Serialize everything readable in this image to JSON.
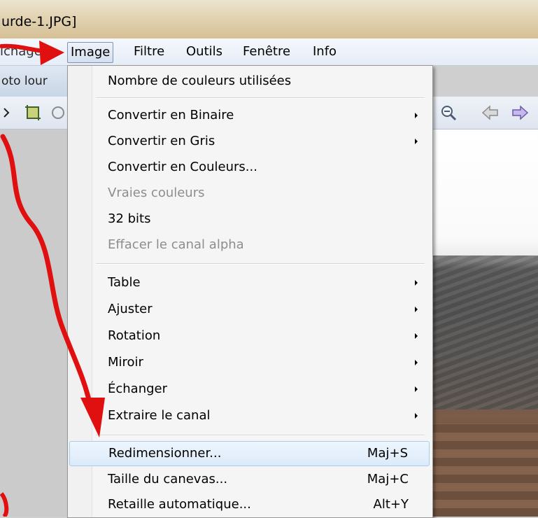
{
  "window": {
    "title_fragment": "urde-1.JPG]"
  },
  "menubar": {
    "partial_item": "ichage",
    "items": [
      {
        "label": "Image",
        "active": true
      },
      {
        "label": "Filtre"
      },
      {
        "label": "Outils"
      },
      {
        "label": "Fenêtre"
      },
      {
        "label": "Info"
      }
    ]
  },
  "tabstrip": {
    "tab_fragment": "oto lour"
  },
  "toolbar": {
    "icons": [
      "crop-icon",
      "zoom-out-icon",
      "back-arrow-icon",
      "forward-arrow-icon"
    ]
  },
  "image_menu": {
    "items": [
      {
        "label": "Nombre de couleurs utilisées",
        "enabled": true
      },
      {
        "label": "Convertir en Binaire",
        "enabled": true,
        "submenu": true
      },
      {
        "label": "Convertir en Gris",
        "enabled": true,
        "submenu": true
      },
      {
        "label": "Convertir en Couleurs...",
        "enabled": true
      },
      {
        "label": "Vraies couleurs",
        "enabled": false
      },
      {
        "label": "32 bits",
        "enabled": true
      },
      {
        "label": "Effacer le canal alpha",
        "enabled": false
      },
      {
        "label": "Table",
        "enabled": true,
        "submenu": true
      },
      {
        "label": "Ajuster",
        "enabled": true,
        "submenu": true
      },
      {
        "label": "Rotation",
        "enabled": true,
        "submenu": true
      },
      {
        "label": "Miroir",
        "enabled": true,
        "submenu": true
      },
      {
        "label": "Échanger",
        "enabled": true,
        "submenu": true
      },
      {
        "label": "Extraire le canal",
        "enabled": true,
        "submenu": true
      },
      {
        "label": "Redimensionner...",
        "shortcut": "Maj+S",
        "enabled": true,
        "highlighted": true
      },
      {
        "label": "Taille du canevas...",
        "shortcut": "Maj+C",
        "enabled": true
      },
      {
        "label": "Retaille automatique...",
        "shortcut": "Alt+Y",
        "enabled": true
      }
    ]
  },
  "colors": {
    "annotation_red": "#e01010",
    "highlight": "#dceaf9",
    "disabled_text": "#8d8d8d"
  }
}
